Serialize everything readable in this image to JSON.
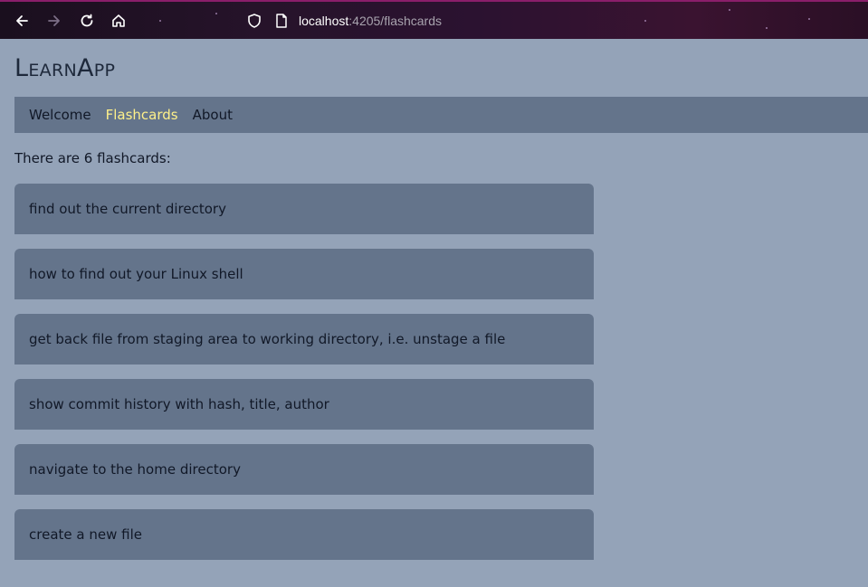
{
  "browser": {
    "url_host": "localhost",
    "url_rest": ":4205/flashcards",
    "icons": [
      "back-arrow-icon",
      "forward-arrow-icon",
      "reload-icon",
      "home-icon",
      "shield-icon",
      "page-icon"
    ]
  },
  "app": {
    "title": "LearnApp"
  },
  "nav": {
    "items": [
      {
        "label": "Welcome",
        "active": false
      },
      {
        "label": "Flashcards",
        "active": true
      },
      {
        "label": "About",
        "active": false
      }
    ]
  },
  "flashcards": {
    "count_text": "There are 6 flashcards:",
    "items": [
      {
        "front": "find out the current directory"
      },
      {
        "front": "how to find out your Linux shell"
      },
      {
        "front": "get back file from staging area to working directory, i.e. unstage a file"
      },
      {
        "front": "show commit history with hash, title, author"
      },
      {
        "front": "navigate to the home directory"
      },
      {
        "front": "create a new file"
      }
    ]
  },
  "colors": {
    "page_bg": "#94a3b8",
    "nav_bg": "#64748b",
    "card_bg": "#64748b",
    "active_link": "#fef08a",
    "title": "#1e293b"
  }
}
